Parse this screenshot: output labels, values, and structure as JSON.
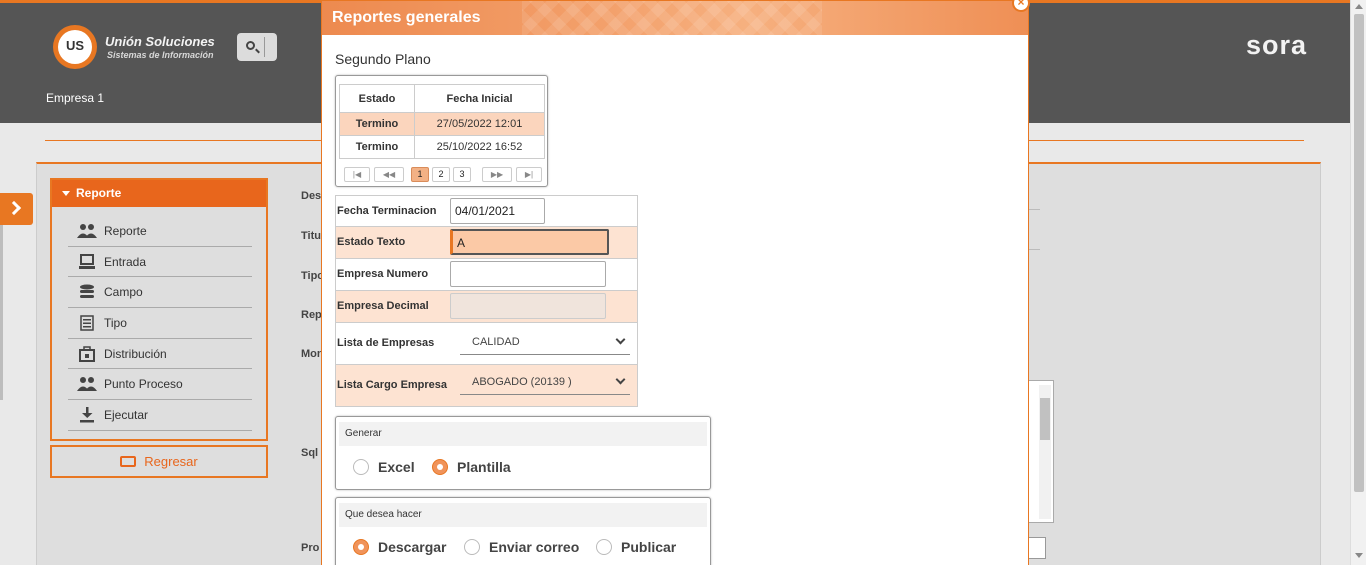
{
  "header": {
    "logo_name": "Unión Soluciones",
    "logo_sub": "Sistemas de Información",
    "logo_mark": "US",
    "company": "Empresa 1",
    "brand": "sora",
    "accent": "#e87722"
  },
  "sidebar": {
    "title": "Reporte",
    "items": [
      {
        "label": "Reporte",
        "icon": "users-icon"
      },
      {
        "label": "Entrada",
        "icon": "monitor-icon"
      },
      {
        "label": "Campo",
        "icon": "database-icon"
      },
      {
        "label": "Tipo",
        "icon": "list-icon"
      },
      {
        "label": "Distribución",
        "icon": "briefcase-icon"
      },
      {
        "label": "Punto Proceso",
        "icon": "users-icon"
      },
      {
        "label": "Ejecutar",
        "icon": "download-icon"
      }
    ],
    "back_label": "Regresar"
  },
  "background_labels": [
    "Des",
    "Titu",
    "Tipo",
    "Rep",
    "Mon",
    "Sql",
    "Pro"
  ],
  "modal": {
    "title": "Reportes generales",
    "close": "×",
    "subtitle": "Segundo Plano",
    "grid": {
      "headers": [
        "Estado",
        "Fecha Inicial"
      ],
      "rows": [
        {
          "estado": "Termino",
          "fecha": "27/05/2022 12:01"
        },
        {
          "estado": "Termino",
          "fecha": "25/10/2022 16:52"
        }
      ],
      "pager": {
        "first": "|◀",
        "prev": "◀◀",
        "pages": [
          "1",
          "2",
          "3"
        ],
        "active_page": "1",
        "next": "▶▶",
        "last": "▶|"
      }
    },
    "form": {
      "fecha_terminacion": {
        "label": "Fecha Terminacion",
        "value": "04/01/2021"
      },
      "estado_texto": {
        "label": "Estado Texto",
        "value": "A"
      },
      "empresa_numero": {
        "label": "Empresa Numero",
        "value": ""
      },
      "empresa_decimal": {
        "label": "Empresa Decimal",
        "value": ""
      },
      "lista_empresas": {
        "label": "Lista de Empresas",
        "value": "CALIDAD"
      },
      "lista_cargo": {
        "label": "Lista Cargo Empresa",
        "value": "ABOGADO (20139 )"
      }
    },
    "generar": {
      "title": "Generar",
      "options": [
        "Excel",
        "Plantilla"
      ],
      "selected": "Plantilla"
    },
    "accion": {
      "title": "Que desea hacer",
      "options": [
        "Descargar",
        "Enviar correo",
        "Publicar"
      ],
      "selected": "Descargar"
    }
  }
}
